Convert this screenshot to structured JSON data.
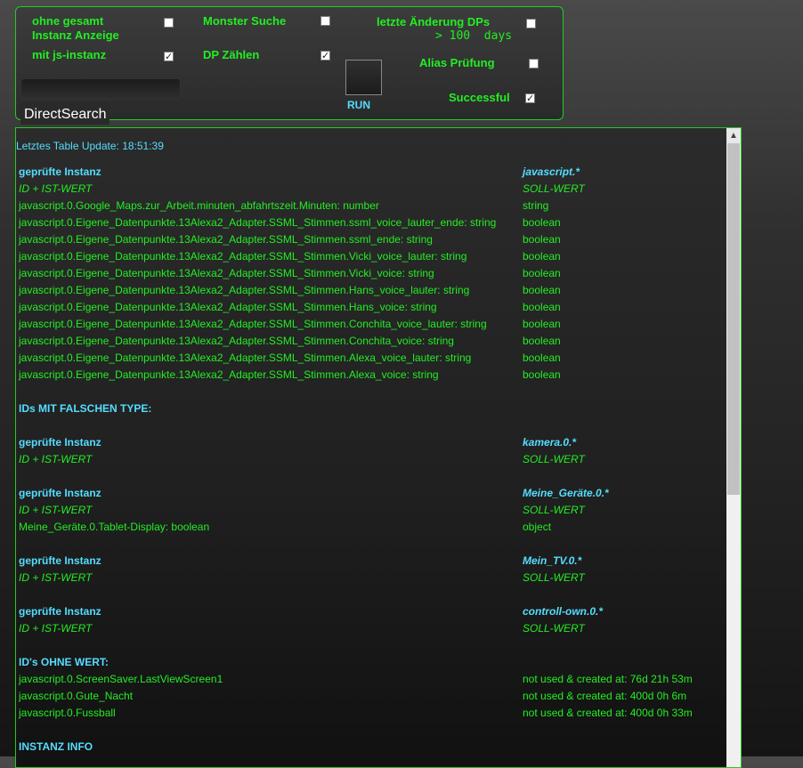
{
  "controls": {
    "ohne_gesamt_label_1": "ohne gesamt",
    "ohne_gesamt_label_2": "Instanz Anzeige",
    "mit_js_label": "mit js-instanz",
    "monster_label": "Monster Suche",
    "dp_zaehlen_label": "DP Zählen",
    "letzte_aenderung_label": "letzte Änderung DPs",
    "days_text": "> 100  days",
    "alias_label": "Alias Prüfung",
    "successful_label": "Successful",
    "run_label": "RUN",
    "direct_search_label": "DirectSearch",
    "checkbox_states": {
      "ohne_gesamt": false,
      "mit_js": true,
      "monster": false,
      "dp_zaehlen": true,
      "letzte_aenderung": false,
      "alias": false,
      "successful": true
    }
  },
  "table": {
    "update_text": "Letztes Table Update: 18:51:39",
    "rows": [
      {
        "type": "hdr",
        "c1": "geprüfte Instanz",
        "c2": "javascript.*"
      },
      {
        "type": "sub",
        "c1": "ID + IST-WERT",
        "c2": "SOLL-WERT"
      },
      {
        "type": "id",
        "c1": "javascript.0.Google_Maps.zur_Arbeit.minuten_abfahrtszeit.Minuten: number",
        "c2": "string"
      },
      {
        "type": "id",
        "c1": "javascript.0.Eigene_Datenpunkte.13Alexa2_Adapter.SSML_Stimmen.ssml_voice_lauter_ende: string",
        "c2": "boolean"
      },
      {
        "type": "id",
        "c1": "javascript.0.Eigene_Datenpunkte.13Alexa2_Adapter.SSML_Stimmen.ssml_ende: string",
        "c2": "boolean"
      },
      {
        "type": "id",
        "c1": "javascript.0.Eigene_Datenpunkte.13Alexa2_Adapter.SSML_Stimmen.Vicki_voice_lauter: string",
        "c2": "boolean"
      },
      {
        "type": "id",
        "c1": "javascript.0.Eigene_Datenpunkte.13Alexa2_Adapter.SSML_Stimmen.Vicki_voice: string",
        "c2": "boolean"
      },
      {
        "type": "id",
        "c1": "javascript.0.Eigene_Datenpunkte.13Alexa2_Adapter.SSML_Stimmen.Hans_voice_lauter: string",
        "c2": "boolean"
      },
      {
        "type": "id",
        "c1": "javascript.0.Eigene_Datenpunkte.13Alexa2_Adapter.SSML_Stimmen.Hans_voice: string",
        "c2": "boolean"
      },
      {
        "type": "id",
        "c1": "javascript.0.Eigene_Datenpunkte.13Alexa2_Adapter.SSML_Stimmen.Conchita_voice_lauter: string",
        "c2": "boolean"
      },
      {
        "type": "id",
        "c1": "javascript.0.Eigene_Datenpunkte.13Alexa2_Adapter.SSML_Stimmen.Conchita_voice: string",
        "c2": "boolean"
      },
      {
        "type": "id",
        "c1": "javascript.0.Eigene_Datenpunkte.13Alexa2_Adapter.SSML_Stimmen.Alexa_voice_lauter: string",
        "c2": "boolean"
      },
      {
        "type": "id",
        "c1": "javascript.0.Eigene_Datenpunkte.13Alexa2_Adapter.SSML_Stimmen.Alexa_voice: string",
        "c2": "boolean"
      },
      {
        "type": "blank",
        "c1": "",
        "c2": ""
      },
      {
        "type": "sec",
        "c1": "IDs MIT FALSCHEN TYPE:",
        "c2": ""
      },
      {
        "type": "blank",
        "c1": "",
        "c2": ""
      },
      {
        "type": "hdr",
        "c1": "geprüfte Instanz",
        "c2": "kamera.0.*"
      },
      {
        "type": "sub",
        "c1": "ID + IST-WERT",
        "c2": "SOLL-WERT"
      },
      {
        "type": "blank",
        "c1": "",
        "c2": ""
      },
      {
        "type": "hdr",
        "c1": "geprüfte Instanz",
        "c2": "Meine_Geräte.0.*"
      },
      {
        "type": "sub",
        "c1": "ID + IST-WERT",
        "c2": "SOLL-WERT"
      },
      {
        "type": "id",
        "c1": "Meine_Geräte.0.Tablet-Display: boolean",
        "c2": "object"
      },
      {
        "type": "blank",
        "c1": "",
        "c2": ""
      },
      {
        "type": "hdr",
        "c1": "geprüfte Instanz",
        "c2": "Mein_TV.0.*"
      },
      {
        "type": "sub",
        "c1": "ID + IST-WERT",
        "c2": "SOLL-WERT"
      },
      {
        "type": "blank",
        "c1": "",
        "c2": ""
      },
      {
        "type": "hdr",
        "c1": "geprüfte Instanz",
        "c2": "controll-own.0.*"
      },
      {
        "type": "sub",
        "c1": "ID + IST-WERT",
        "c2": "SOLL-WERT"
      },
      {
        "type": "blank",
        "c1": "",
        "c2": ""
      },
      {
        "type": "sec",
        "c1": "ID's OHNE WERT:",
        "c2": ""
      },
      {
        "type": "id",
        "c1": "javascript.0.ScreenSaver.LastViewScreen1",
        "c2": "not used & created at: 76d 21h 53m"
      },
      {
        "type": "id",
        "c1": "javascript.0.Gute_Nacht",
        "c2": "not used & created at: 400d 0h 6m"
      },
      {
        "type": "id",
        "c1": "javascript.0.Fussball",
        "c2": "not used & created at: 400d 0h 33m"
      },
      {
        "type": "blank",
        "c1": "",
        "c2": ""
      },
      {
        "type": "sec",
        "c1": "INSTANZ INFO",
        "c2": ""
      }
    ]
  }
}
